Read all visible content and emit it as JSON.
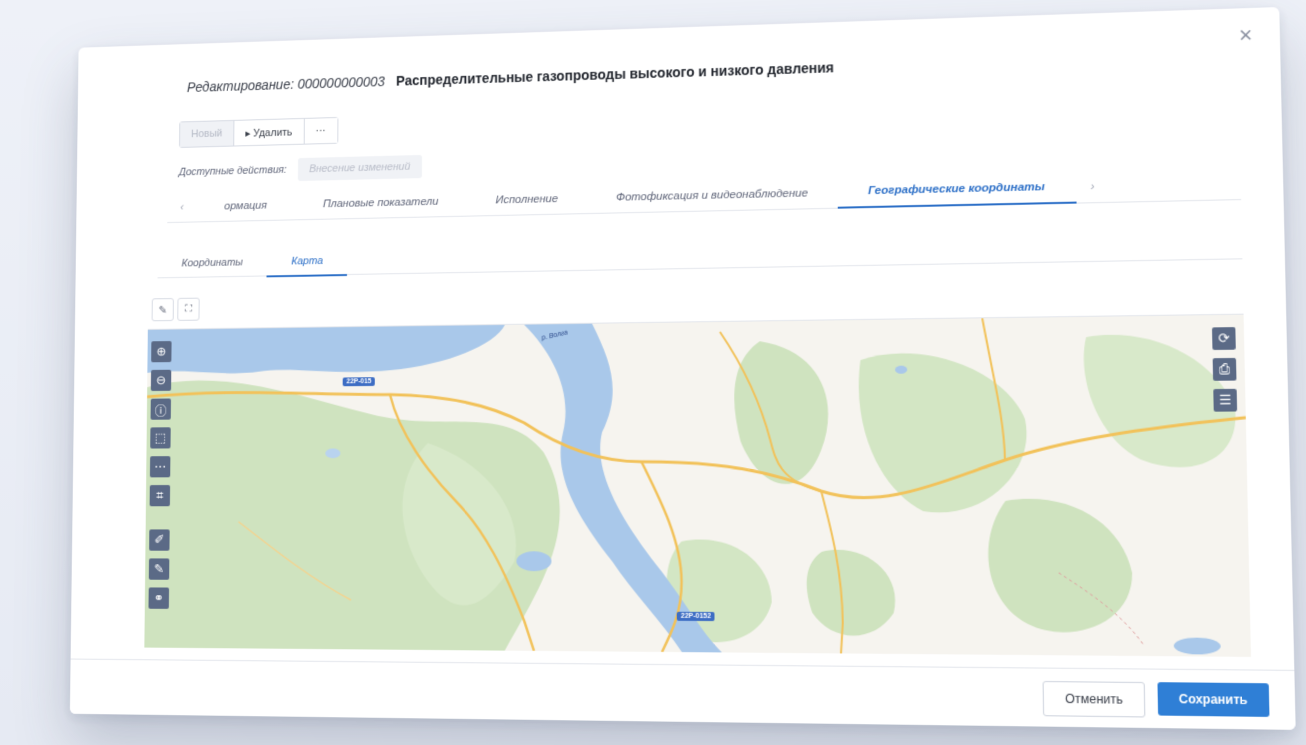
{
  "dialog": {
    "title_prefix": "Редактирование:",
    "record_number": "000000000003",
    "title": "Распределительные газопроводы высокого и низкого давления",
    "close_symbol": "×"
  },
  "toolbar": {
    "new_label": "Новый",
    "delete_label": "▸ Удалить",
    "more_label": "···"
  },
  "actions": {
    "label": "Доступные действия:",
    "button_label": "Внесение изменений"
  },
  "tabs": {
    "prev_arrow": "‹",
    "items": [
      {
        "label": "ормация"
      },
      {
        "label": "Плановые показатели"
      },
      {
        "label": "Исполнение"
      },
      {
        "label": "Фотофиксация и видеонаблюдение"
      },
      {
        "label": "Географические координаты"
      }
    ],
    "next_arrow": "›"
  },
  "subtabs": {
    "items": [
      {
        "label": "Координаты"
      },
      {
        "label": "Карта"
      }
    ]
  },
  "map": {
    "road_badges": [
      "22Р-015",
      "22Р-0152"
    ],
    "river_label": "р. Волга",
    "colors": {
      "water": "#a9c8ea",
      "forest": "#cfe3bf",
      "road": "#f2c25a",
      "land": "#f6f4ef"
    }
  },
  "footer": {
    "cancel_label": "Отменить",
    "save_label": "Сохранить"
  }
}
